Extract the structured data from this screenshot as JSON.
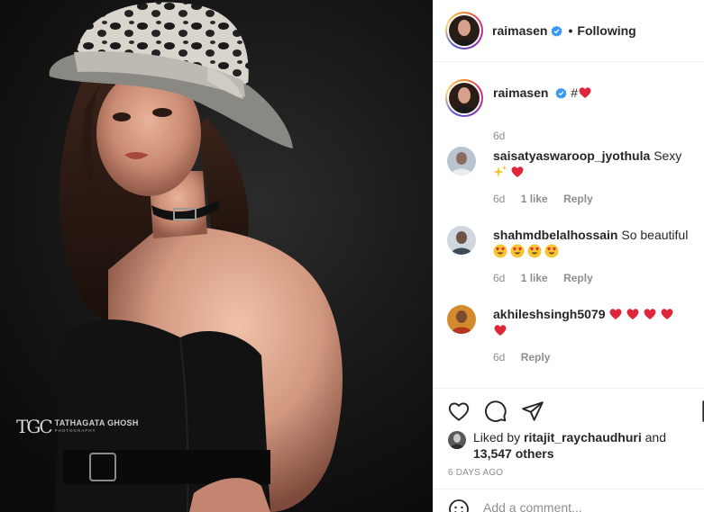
{
  "post": {
    "photo_alt": "raimasen post photo",
    "watermark": {
      "monogram": "TGC",
      "name": "TATHAGATA GHOSH",
      "sub": "PHOTOGRAPHY"
    }
  },
  "header": {
    "username": "raimasen",
    "separator": "•",
    "follow_status": "Following"
  },
  "caption": {
    "username": "raimasen",
    "text": "#",
    "time": "6d"
  },
  "comments": [
    {
      "username": "saisatyaswaroop_jyothula",
      "text": "Sexy",
      "time": "6d",
      "likes": "1 like",
      "reply": "Reply"
    },
    {
      "username": "shahmdbelalhossain",
      "text": "So beautiful",
      "time": "6d",
      "likes": "1 like",
      "reply": "Reply"
    },
    {
      "username": "akhileshsingh5079",
      "text": "",
      "time": "6d",
      "likes": "",
      "reply": "Reply"
    }
  ],
  "likes": {
    "prefix": "Liked by",
    "user": "ritajit_raychaudhuri",
    "middle": "and",
    "count": "13,547 others"
  },
  "timestamp": "6 DAYS AGO",
  "add_comment_placeholder": "Add a comment...",
  "icons": [
    "heart-icon",
    "comment-icon",
    "share-icon",
    "save-icon",
    "verified-badge-icon",
    "smiley-icon"
  ],
  "colors": {
    "verified": "#3897f0",
    "muted": "#8e8e8e",
    "heart": "#ed4956"
  }
}
